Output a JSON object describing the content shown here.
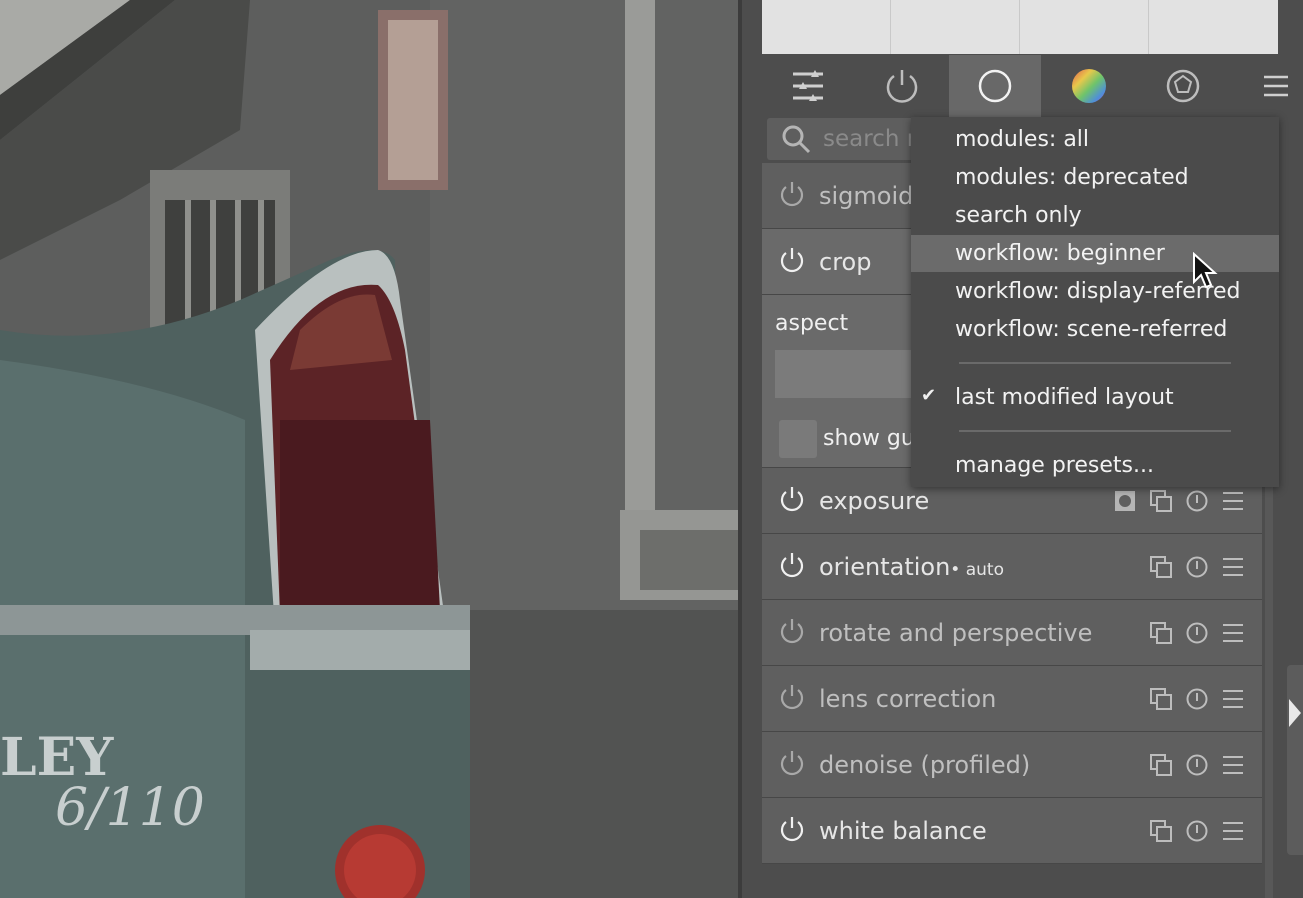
{
  "photo": {
    "badge_text": "LEY",
    "badge_model": "6/110"
  },
  "tabs": [
    {
      "name": "tab-quick-access",
      "icon": "sliders-icon"
    },
    {
      "name": "tab-active-modules",
      "icon": "power-icon"
    },
    {
      "name": "tab-base",
      "icon": "circle-icon",
      "active": true
    },
    {
      "name": "tab-tone",
      "icon": "color-wheel-icon"
    },
    {
      "name": "tab-effects",
      "icon": "aperture-icon"
    },
    {
      "name": "tab-presets-menu",
      "icon": "hamburger-icon"
    }
  ],
  "search": {
    "placeholder": "search m"
  },
  "modules": {
    "sigmoid": "sigmoid",
    "crop": "crop",
    "crop_aspect": "aspect",
    "crop_show_guides": "show gu",
    "exposure": "exposure",
    "orientation": "orientation",
    "orientation_sub": "• auto",
    "rotate": "rotate and perspective",
    "lens": "lens correction",
    "denoise": "denoise (profiled)",
    "white_balance": "white balance"
  },
  "dropdown": {
    "items": [
      "modules: all",
      "modules: deprecated",
      "search only",
      "workflow: beginner",
      "workflow: display-referred",
      "workflow: scene-referred"
    ],
    "highlighted": "workflow: beginner",
    "checked_item": "last modified layout",
    "check_glyph": "✔",
    "manage": "manage presets..."
  },
  "colors": {
    "accent_active_tab": "#686868",
    "highlight": "#6b6b6b",
    "panel": "#4d4d4d"
  }
}
